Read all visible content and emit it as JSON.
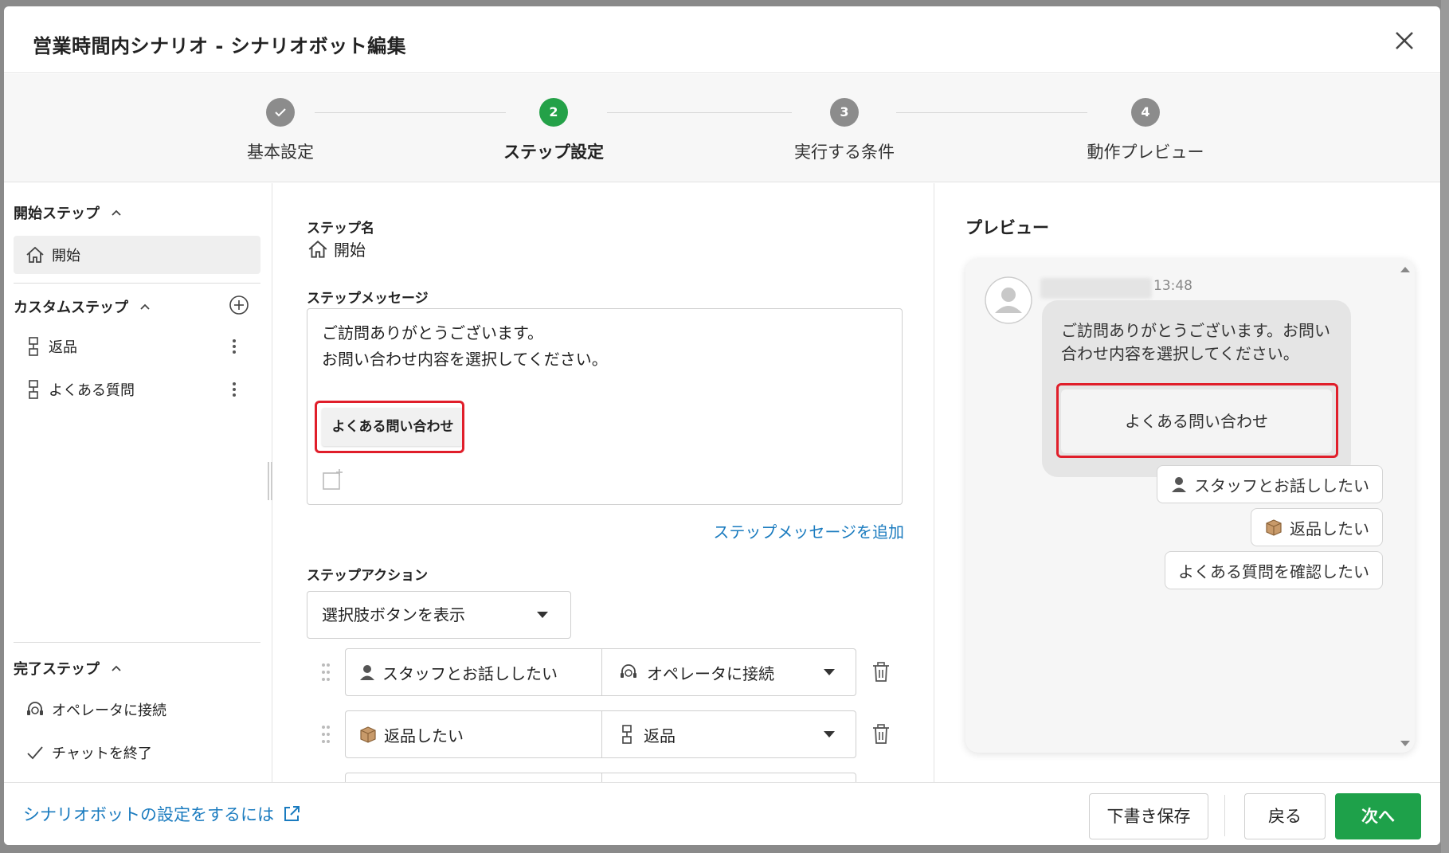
{
  "modal": {
    "title": "営業時間内シナリオ - シナリオボット編集"
  },
  "stepper": {
    "steps": [
      {
        "number": "✓",
        "label": "基本設定",
        "state": "done"
      },
      {
        "number": "2",
        "label": "ステップ設定",
        "state": "active"
      },
      {
        "number": "3",
        "label": "実行する条件",
        "state": "pending"
      },
      {
        "number": "4",
        "label": "動作プレビュー",
        "state": "pending"
      }
    ],
    "colors": {
      "active": "#24a148",
      "inactive": "#8c8c8c"
    }
  },
  "sidebar": {
    "start_section": {
      "title": "開始ステップ",
      "items": [
        {
          "label": "開始",
          "icon": "home-icon"
        }
      ]
    },
    "custom_section": {
      "title": "カスタムステップ",
      "items": [
        {
          "label": "返品",
          "icon": "step-node-icon"
        },
        {
          "label": "よくある質問",
          "icon": "step-node-icon"
        }
      ]
    },
    "end_section": {
      "title": "完了ステップ",
      "items": [
        {
          "label": "オペレータに接続",
          "icon": "operator-headset-icon"
        },
        {
          "label": "チャットを終了",
          "icon": "check-icon"
        }
      ]
    }
  },
  "editor": {
    "step_name_label": "ステップ名",
    "step_name": "開始",
    "message_label": "ステップメッセージ",
    "message_text": "ご訪問ありがとうございます。\nお問い合わせ内容を選択してください。",
    "message_choice": "よくある問い合わせ",
    "add_message_link": "ステップメッセージを追加",
    "action_label": "ステップアクション",
    "action_select": "選択肢ボタンを表示",
    "action_rows": [
      {
        "choice": "スタッフとお話ししたい",
        "choice_icon": "staff-person-icon",
        "target": "オペレータに接続",
        "target_icon": "operator-headset-icon"
      },
      {
        "choice": "返品したい",
        "choice_icon": "package-box-icon",
        "target": "返品",
        "target_icon": "step-node-icon"
      }
    ],
    "highlight_color": "#e01e2a"
  },
  "preview": {
    "title": "プレビュー",
    "timestamp": "13:48",
    "bubble_text": "ご訪問ありがとうございます。お問い合わせ内容を選択してください。",
    "bubble_button": "よくある問い合わせ",
    "quick_replies": [
      {
        "label": "スタッフとお話ししたい",
        "icon": "staff-person-icon"
      },
      {
        "label": "返品したい",
        "icon": "package-box-icon"
      },
      {
        "label": "よくある質問を確認したい",
        "icon": ""
      }
    ]
  },
  "footer": {
    "help_link": "シナリオボットの設定をするには",
    "save_draft": "下書き保存",
    "back": "戻る",
    "next": "次へ",
    "primary_color": "#1ea14a"
  }
}
